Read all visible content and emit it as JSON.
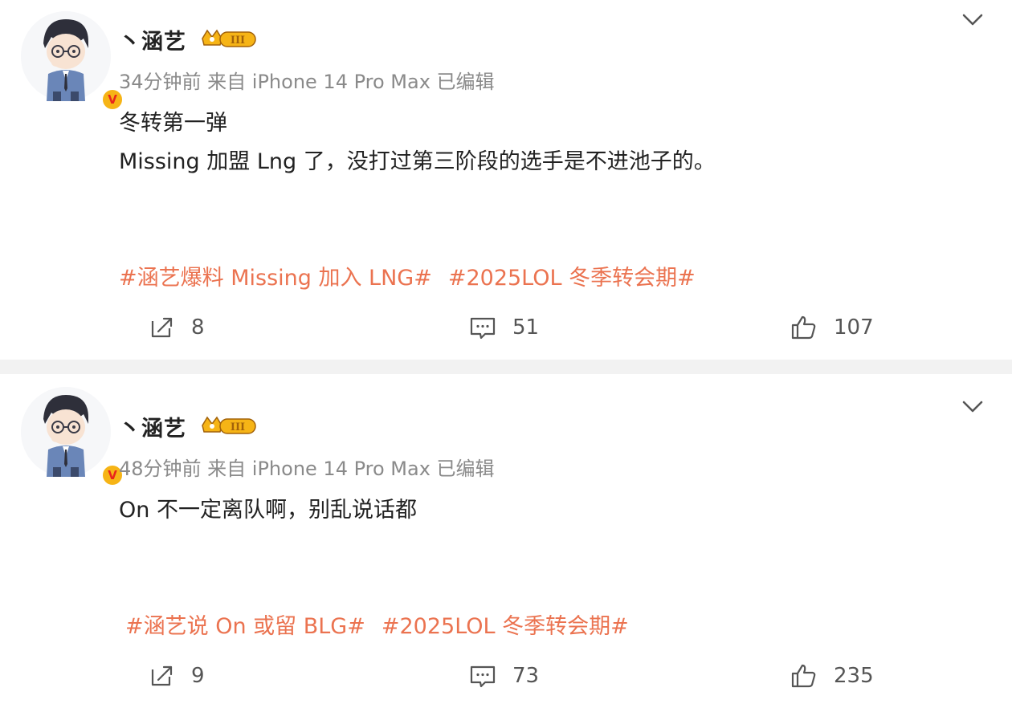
{
  "posts": [
    {
      "username": "丶涵艺",
      "rank_badge": "III",
      "verified_badge": "V",
      "meta": "34分钟前 来自 iPhone 14 Pro Max 已编辑",
      "body_lines": [
        "冬转第一弹",
        "Missing 加盟 Lng 了，没打过第三阶段的选手是不进池子的。"
      ],
      "tags": [
        "#涵艺爆料 Missing 加入 LNG#",
        "#2025LOL 冬季转会期#"
      ],
      "actions": {
        "repost": "8",
        "comment": "51",
        "like": "107"
      }
    },
    {
      "username": "丶涵艺",
      "rank_badge": "III",
      "verified_badge": "V",
      "meta": "48分钟前 来自 iPhone 14 Pro Max 已编辑",
      "body_lines": [
        "On 不一定离队啊，别乱说话都"
      ],
      "tags": [
        "#涵艺说 On 或留 BLG#",
        "#2025LOL 冬季转会期#"
      ],
      "actions": {
        "repost": "9",
        "comment": "73",
        "like": "235"
      }
    }
  ],
  "icons": {
    "repost": "repost-icon",
    "comment": "comment-icon",
    "like": "like-icon",
    "caret": "chevron-down-icon"
  },
  "colors": {
    "tag": "#eb7350",
    "meta": "#8a8a8a",
    "badge_gold": "#f6b416",
    "verified_red": "#e8251c",
    "divider": "#f2f2f2"
  }
}
